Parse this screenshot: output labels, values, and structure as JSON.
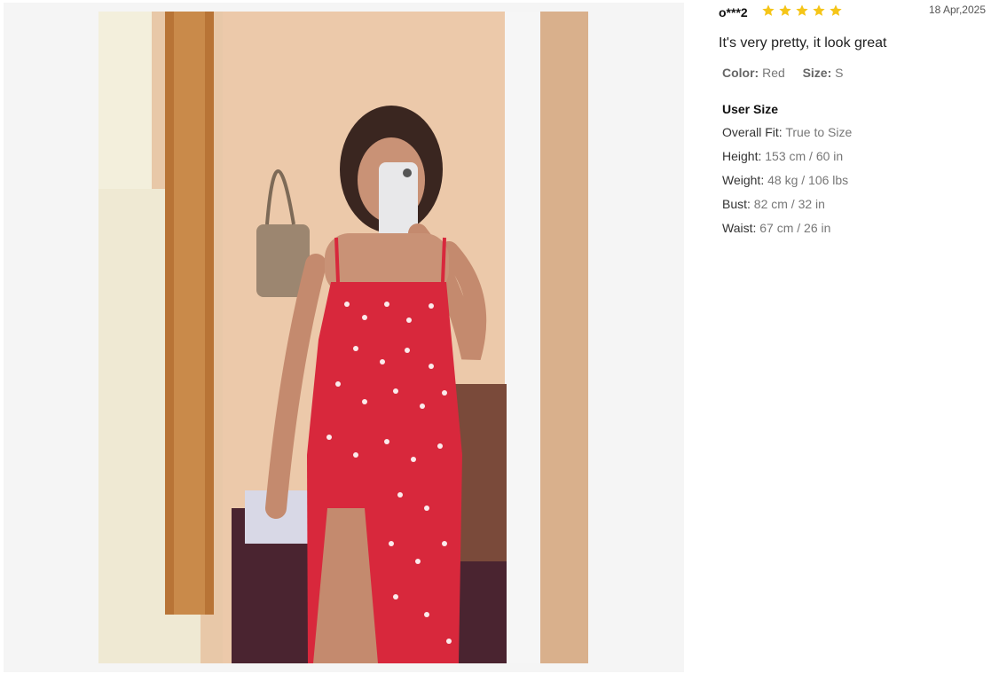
{
  "review": {
    "reviewer": "o***2",
    "rating": 5,
    "date": "18 Apr,2025",
    "text": "It's very pretty, it look great",
    "color_label": "Color:",
    "color_value": "Red",
    "size_label": "Size:",
    "size_value": "S"
  },
  "user_size": {
    "title": "User Size",
    "rows": [
      {
        "label": "Overall Fit:",
        "value": "True to Size"
      },
      {
        "label": "Height:",
        "value": "153 cm / 60 in"
      },
      {
        "label": "Weight:",
        "value": "48 kg / 106 lbs"
      },
      {
        "label": "Bust:",
        "value": "82 cm / 32 in"
      },
      {
        "label": "Waist:",
        "value": "67 cm / 26 in"
      }
    ]
  },
  "colors": {
    "star": "#f5c518",
    "dress": "#d8283c",
    "wall": "#e8c8a8"
  }
}
